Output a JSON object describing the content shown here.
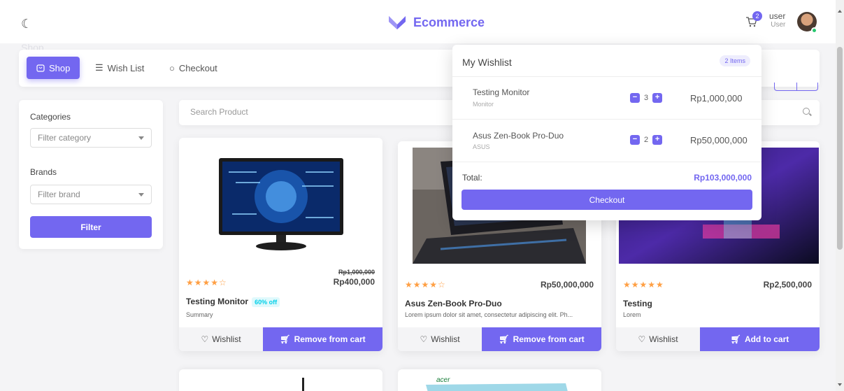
{
  "navbar": {
    "brand_name": "Ecommerce",
    "cart_count": "2",
    "user_name": "user",
    "user_role": "User"
  },
  "page_title": "Shop",
  "tabs": [
    {
      "label": "Shop",
      "active": true
    },
    {
      "label": "Wish List",
      "active": false
    },
    {
      "label": "Checkout",
      "active": false
    }
  ],
  "sidebar": {
    "categories_label": "Categories",
    "category_placeholder": "Filter category",
    "brands_label": "Brands",
    "brand_placeholder": "Filter brand",
    "filter_button": "Filter"
  },
  "search": {
    "placeholder": "Search Product"
  },
  "products": [
    {
      "name": "Testing Monitor",
      "discount": "60% off",
      "description": "Summary",
      "old_price": "Rp1,000,000",
      "price": "Rp400,000",
      "rating": 4,
      "wishlist_label": "Wishlist",
      "cart_label": "Remove from cart"
    },
    {
      "name": "Asus Zen-Book Pro-Duo",
      "discount": "",
      "description": "Lorem ipsum dolor sit amet, consectetur adipiscing elit. Ph...",
      "old_price": "",
      "price": "Rp50,000,000",
      "rating": 4,
      "wishlist_label": "Wishlist",
      "cart_label": "Remove from cart"
    },
    {
      "name": "Testing",
      "discount": "",
      "description": "Lorem",
      "old_price": "",
      "price": "Rp2,500,000",
      "rating": 5,
      "wishlist_label": "Wishlist",
      "cart_label": "Add to cart"
    }
  ],
  "peek_cards": [
    {
      "brand_text": ""
    },
    {
      "brand_text": "acer"
    }
  ],
  "wishlist": {
    "title": "My Wishlist",
    "count_label": "2 Items",
    "items": [
      {
        "name": "Testing Monitor",
        "brand": "Monitor",
        "qty": "3",
        "price": "Rp1,000,000"
      },
      {
        "name": "Asus Zen-Book Pro-Duo",
        "brand": "ASUS",
        "qty": "2",
        "price": "Rp50,000,000"
      }
    ],
    "total_label": "Total:",
    "total_value": "Rp103,000,000",
    "checkout_label": "Checkout"
  },
  "colors": {
    "accent": "#7367f0",
    "star": "#ff9f43",
    "discount": "#00cfe8"
  }
}
